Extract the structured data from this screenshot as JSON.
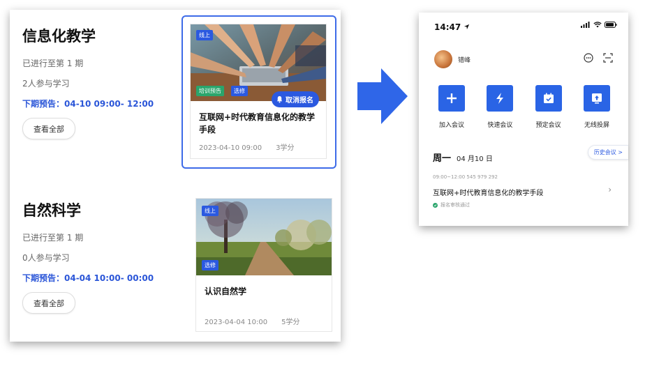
{
  "courses": [
    {
      "title": "信息化教学",
      "progress": "已进行至第 1 期",
      "participants": "2人参与学习",
      "preview": "下期预告：04-10 09:00- 12:00",
      "view_all": "查看全部",
      "card": {
        "tag_top": "线上",
        "tag_bottom_1": "培训预告",
        "tag_bottom_2": "选修",
        "cancel_label": "取消报名",
        "title": "互联网+时代教育信息化的教学手段",
        "date": "2023-04-10 09:00",
        "credits": "3学分",
        "selected": true
      }
    },
    {
      "title": "自然科学",
      "progress": "已进行至第 1 期",
      "participants": "0人参与学习",
      "preview": "下期预告：04-04 10:00- 00:00",
      "view_all": "查看全部",
      "card": {
        "tag_top": "线上",
        "tag_bottom_1": "选修",
        "title": "认识自然学",
        "date": "2023-04-04 10:00",
        "credits": "5学分",
        "selected": false
      }
    }
  ],
  "phone": {
    "time": "14:47",
    "user_name": "错峰",
    "actions": [
      {
        "label": "加入会议",
        "icon": "plus-icon"
      },
      {
        "label": "快速会议",
        "icon": "lightning-icon"
      },
      {
        "label": "预定会议",
        "icon": "calendar-icon"
      },
      {
        "label": "无线投屏",
        "icon": "screen-share-icon"
      }
    ],
    "day_week": "周一",
    "day_date": "04 月10 日",
    "history_label": "历史会议 >",
    "meeting": {
      "time_and_id": "09:00~12:00  545 979 292",
      "title": "互联网+时代教育信息化的教学手段",
      "status": "报名审核通过"
    }
  },
  "colors": {
    "accent": "#2b59e0",
    "preview_text": "#2b56d8",
    "status_green": "#2aa56c"
  }
}
